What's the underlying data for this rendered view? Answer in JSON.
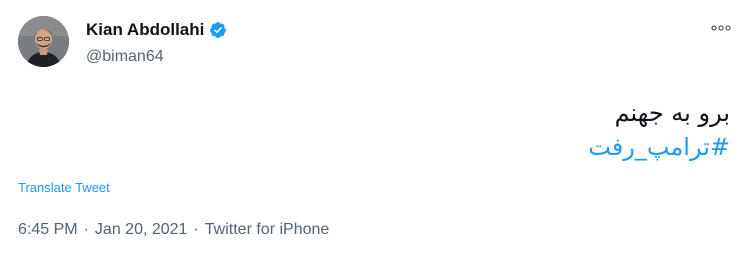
{
  "author": {
    "display_name": "Kian Abdollahi",
    "handle": "@biman64",
    "verified": true,
    "avatar_icon": "profile-photo"
  },
  "more_icon": "more-options-icon",
  "tweet": {
    "line1": "برو به جهنم",
    "hashtag": "#ترامپ_رفت"
  },
  "translate_label": "Translate Tweet",
  "meta": {
    "time": "6:45 PM",
    "separator": "·",
    "date": "Jan 20, 2021",
    "source": "Twitter for iPhone"
  },
  "colors": {
    "accent": "#1d9bf0",
    "text_primary": "#0f1419",
    "text_secondary": "#536471"
  }
}
